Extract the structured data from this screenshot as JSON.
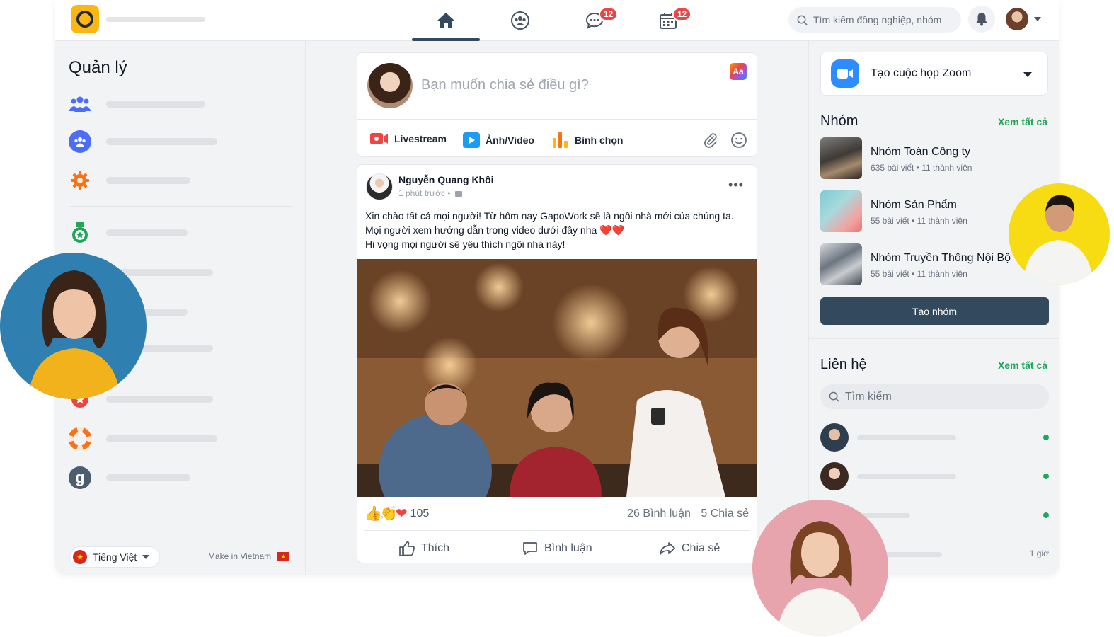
{
  "nav": {
    "messages_badge": "12",
    "calendar_badge": "12",
    "search_placeholder": "Tìm kiếm đồng nghiệp, nhóm"
  },
  "sidebar": {
    "title": "Quản lý",
    "language": "Tiếng Việt",
    "made_in": "Make in Vietnam"
  },
  "composer": {
    "placeholder": "Bạn muốn chia sẻ điều gì?",
    "font_badge": "Aa",
    "actions": [
      "Livestream",
      "Ảnh/Video",
      "Bình chọn"
    ]
  },
  "post": {
    "author": "Nguyễn Quang Khôi",
    "time": "1 phút trước •",
    "lines": [
      "Xin chào tất cả mọi người! Từ hôm nay GapoWork sẽ là ngôi nhà mới của chúng ta.",
      "Mọi người xem hướng dẫn trong video dưới đây nha ❤️❤️",
      "Hi vọng mọi người sẽ yêu thích ngôi nhà này!"
    ],
    "reaction_count": "105",
    "comments": "26 Bình luận",
    "shares": "5 Chia sẻ",
    "like_label": "Thích",
    "comment_label": "Bình luận",
    "share_label": "Chia sẻ"
  },
  "right": {
    "zoom_label": "Tạo cuộc họp Zoom",
    "groups_title": "Nhóm",
    "see_all": "Xem tất cả",
    "groups": [
      {
        "name": "Nhóm Toàn Công ty",
        "posts": "635 bài viết",
        "members": "11 thành viên"
      },
      {
        "name": "Nhóm Sản Phẩm",
        "posts": "55 bài viết",
        "members": "11 thành viên"
      },
      {
        "name": "Nhóm Truyền Thông Nội Bộ",
        "posts": "55 bài viết",
        "members": "11 thành viên"
      }
    ],
    "create_group": "Tạo nhóm",
    "contacts_title": "Liên hệ",
    "contacts_search": "Tìm kiếm",
    "last_contact_time": "1 giờ"
  },
  "colors": {
    "brand_yellow": "#fdb713",
    "primary_dark": "#334a5e",
    "green": "#22a559",
    "badge_red": "#ef4444",
    "zoom_blue": "#2d8cff"
  }
}
